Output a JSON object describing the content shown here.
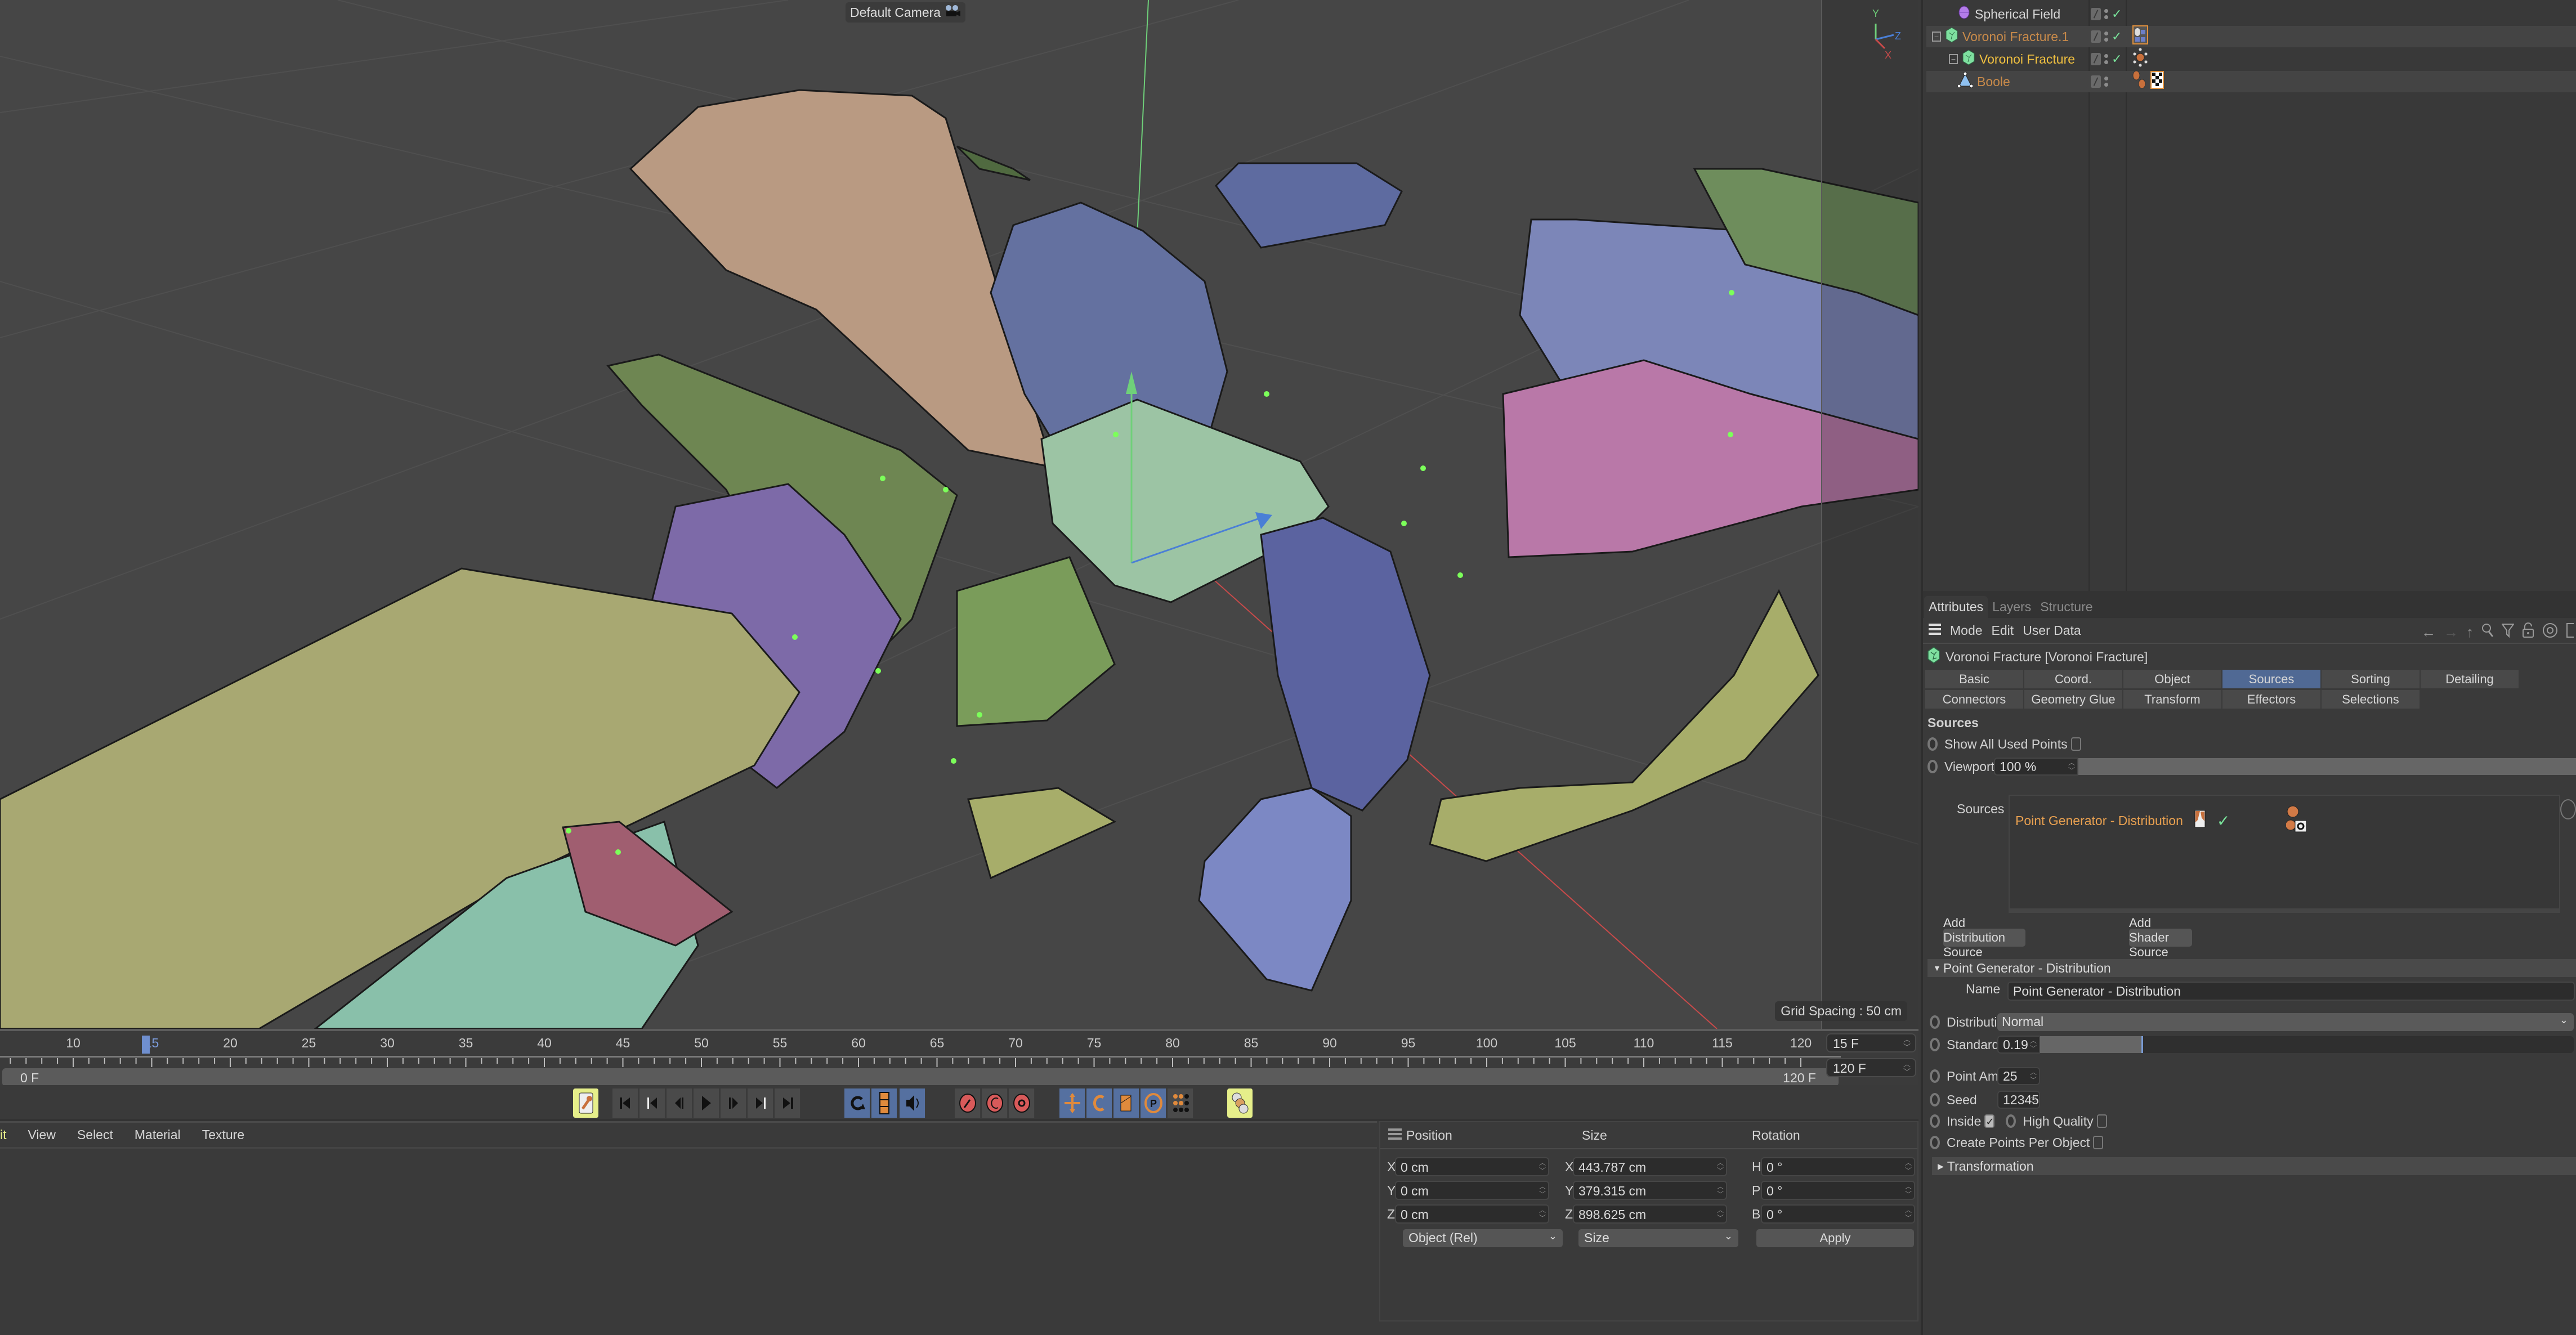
{
  "viewport": {
    "camera_label": "Default Camera",
    "grid_spacing": "Grid Spacing : 50 cm",
    "axis_labels": {
      "x": "X",
      "y": "Y",
      "z": "Z"
    },
    "colors": {
      "background": "#464646",
      "axis_x": "#c84a4a",
      "axis_y": "#6fd07a",
      "axis_z": "#4a7fd6",
      "point": "#7cff5a"
    }
  },
  "timeline": {
    "ticks": [
      "10",
      "15",
      "20",
      "25",
      "30",
      "35",
      "40",
      "45",
      "50",
      "55",
      "60",
      "65",
      "70",
      "75",
      "80",
      "85",
      "90",
      "95",
      "100",
      "105",
      "110",
      "115",
      "120"
    ],
    "current_frame": 15,
    "range_start": "0 F",
    "range_end": "120 F",
    "current_frame_field": "15 F",
    "end_frame_field": "120 F"
  },
  "transport": {
    "buttons": [
      {
        "name": "record-keys-button",
        "icon": "key-icon",
        "style": "yellow"
      },
      {
        "name": "go-to-start-button",
        "icon": "go-to-start-icon"
      },
      {
        "name": "previous-key-button",
        "icon": "previous-key-icon"
      },
      {
        "name": "previous-frame-button",
        "icon": "previous-frame-icon"
      },
      {
        "name": "play-button",
        "icon": "play-icon"
      },
      {
        "name": "next-frame-button",
        "icon": "next-frame-icon"
      },
      {
        "name": "next-key-button",
        "icon": "next-key-icon"
      },
      {
        "name": "go-to-end-button",
        "icon": "go-to-end-icon"
      },
      {
        "name": "loop-button",
        "icon": "loop-icon",
        "style": "blue"
      },
      {
        "name": "film-button",
        "icon": "film-icon",
        "style": "blue"
      },
      {
        "name": "sound-button",
        "icon": "speaker-icon",
        "style": "blue"
      },
      {
        "name": "record-active-button",
        "icon": "record-key-icon"
      },
      {
        "name": "autokey-button",
        "icon": "autokey-icon"
      },
      {
        "name": "keyframe-settings-button",
        "icon": "keyframe-gear-icon"
      },
      {
        "name": "position-key-button",
        "icon": "move-icon",
        "style": "blue"
      },
      {
        "name": "rotation-key-button",
        "icon": "rotate-icon",
        "style": "blue"
      },
      {
        "name": "scale-key-button",
        "icon": "scale-icon",
        "style": "blue"
      },
      {
        "name": "parameter-key-button",
        "icon": "parameter-icon",
        "style": "blue"
      },
      {
        "name": "point-level-button",
        "icon": "points-icon"
      },
      {
        "name": "motion-system-button",
        "icon": "motion-icon",
        "style": "yellow"
      }
    ]
  },
  "material_manager": {
    "menu": [
      "it",
      "View",
      "Select",
      "Material",
      "Texture"
    ]
  },
  "coordinates": {
    "headers": {
      "position": "Position",
      "size": "Size",
      "rotation": "Rotation"
    },
    "rows": [
      {
        "pos_axis": "X",
        "pos": "0 cm",
        "size_axis": "X",
        "size": "443.787 cm",
        "rot_axis": "H",
        "rot": "0 °"
      },
      {
        "pos_axis": "Y",
        "pos": "0 cm",
        "size_axis": "Y",
        "size": "379.315 cm",
        "rot_axis": "P",
        "rot": "0 °"
      },
      {
        "pos_axis": "Z",
        "pos": "0 cm",
        "size_axis": "Z",
        "size": "898.625 cm",
        "rot_axis": "B",
        "rot": "0 °"
      }
    ],
    "mode_select": "Object (Rel)",
    "size_select": "Size",
    "apply_label": "Apply"
  },
  "object_manager": {
    "items": [
      {
        "name": "Spherical Field",
        "color": "#d8d8d8",
        "icon": "spherical-field-icon",
        "checked": true
      },
      {
        "name": "Voronoi Fracture.1",
        "color": "#c88a4a",
        "icon": "voronoi-fracture-icon",
        "checked": true,
        "expander": true
      },
      {
        "name": "Voronoi Fracture",
        "color": "#f0c040",
        "icon": "voronoi-fracture-icon",
        "checked": true,
        "expander": true
      },
      {
        "name": "Boole",
        "color": "#c88a4a",
        "icon": "boole-icon",
        "checked": false
      }
    ]
  },
  "attributes": {
    "tabs": [
      "Attributes",
      "Layers",
      "Structure"
    ],
    "menu": [
      "Mode",
      "Edit",
      "User Data"
    ],
    "object_title": "Voronoi Fracture [Voronoi Fracture]",
    "page_tabs_row1": [
      "Basic",
      "Coord.",
      "Object",
      "Sources",
      "Sorting",
      "Detailing"
    ],
    "page_tabs_row2": [
      "Connectors",
      "Geometry Glue",
      "Transform",
      "Effectors",
      "Selections"
    ],
    "active_page_tab": "Sources",
    "sources_section": {
      "title": "Sources",
      "show_all_used_points_label": "Show All Used Points",
      "show_all_used_points": false,
      "viewport_amount_label": "Viewport Amount",
      "viewport_amount": "100 %",
      "viewport_amount_fraction": 1.0,
      "sources_label": "Sources",
      "source_items": [
        {
          "name": "Point Generator - Distribution",
          "enabled": true
        }
      ],
      "add_distribution_source": "Add Distribution Source",
      "add_shader_source": "Add Shader Source"
    },
    "point_generator": {
      "group_title": "Point Generator - Distribution",
      "name_label": "Name",
      "name_value": "Point Generator - Distribution",
      "distribution_type_label": "Distribution Type",
      "distribution_type": "Normal",
      "std_dev_label": "Standard Deviation",
      "std_dev": "0.19",
      "std_dev_fraction": 0.19,
      "point_amount_label": "Point Amount",
      "point_amount": "25",
      "seed_label": "Seed",
      "seed": "12345",
      "inside_label": "Inside",
      "inside": true,
      "high_quality_label": "High Quality",
      "high_quality": false,
      "create_points_per_object_label": "Create Points Per Object",
      "create_points_per_object": false,
      "transformation_label": "Transformation"
    }
  }
}
